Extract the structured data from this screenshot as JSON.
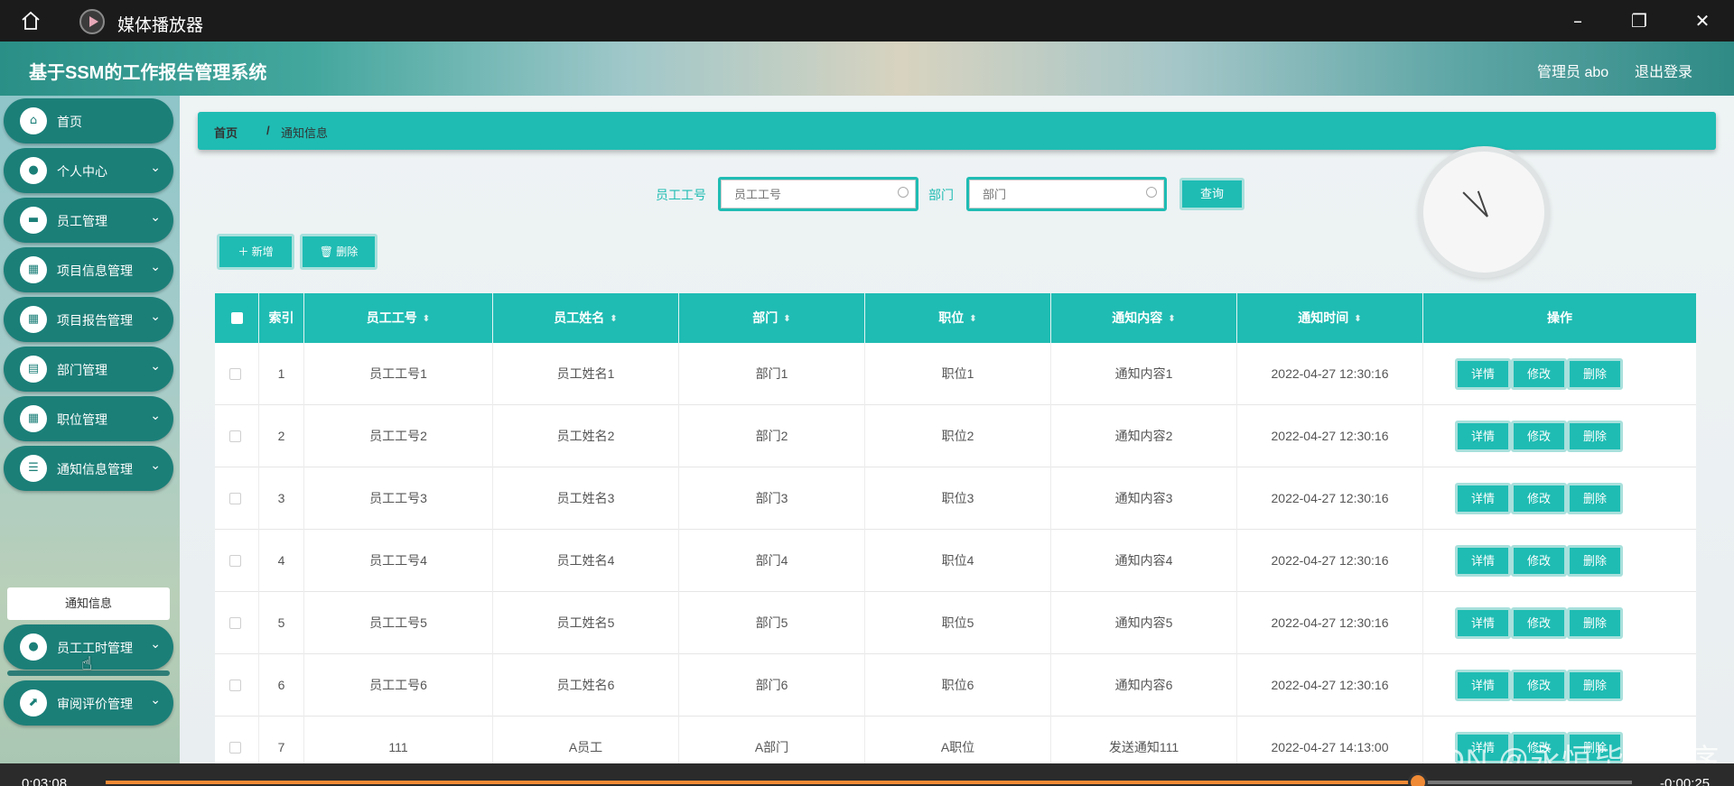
{
  "window": {
    "title": "媒体播放器"
  },
  "header": {
    "app_title": "基于SSM的工作报告管理系统",
    "user": "管理员 abo",
    "logout": "退出登录"
  },
  "sidebar": {
    "items": [
      {
        "label": "首页",
        "icon": "home-icon"
      },
      {
        "label": "个人中心",
        "icon": "user-icon"
      },
      {
        "label": "员工管理",
        "icon": "briefcase-icon"
      },
      {
        "label": "项目信息管理",
        "icon": "grid-icon"
      },
      {
        "label": "项目报告管理",
        "icon": "grid-icon"
      },
      {
        "label": "部门管理",
        "icon": "clipboard-icon"
      },
      {
        "label": "职位管理",
        "icon": "grid-icon"
      },
      {
        "label": "通知信息管理",
        "icon": "list-icon"
      },
      {
        "label": "员工工时管理",
        "icon": "person-icon"
      },
      {
        "label": "审阅评价管理",
        "icon": "chart-icon"
      }
    ],
    "sub_item": "通知信息"
  },
  "breadcrumb": {
    "home": "首页",
    "separator": "/",
    "current": "通知信息"
  },
  "search": {
    "emp_id_label": "员工工号",
    "emp_id_placeholder": "员工工号",
    "dept_label": "部门",
    "dept_placeholder": "部门",
    "query_button": "查询"
  },
  "actions": {
    "add": "＋ 新增",
    "delete": "🗑 删除"
  },
  "table": {
    "columns": [
      "索引",
      "员工工号",
      "员工姓名",
      "部门",
      "职位",
      "通知内容",
      "通知时间",
      "操作"
    ],
    "rows": [
      {
        "index": "1",
        "emp_id": "员工工号1",
        "name": "员工姓名1",
        "dept": "部门1",
        "position": "职位1",
        "content": "通知内容1",
        "time": "2022-04-27 12:30:16"
      },
      {
        "index": "2",
        "emp_id": "员工工号2",
        "name": "员工姓名2",
        "dept": "部门2",
        "position": "职位2",
        "content": "通知内容2",
        "time": "2022-04-27 12:30:16"
      },
      {
        "index": "3",
        "emp_id": "员工工号3",
        "name": "员工姓名3",
        "dept": "部门3",
        "position": "职位3",
        "content": "通知内容3",
        "time": "2022-04-27 12:30:16"
      },
      {
        "index": "4",
        "emp_id": "员工工号4",
        "name": "员工姓名4",
        "dept": "部门4",
        "position": "职位4",
        "content": "通知内容4",
        "time": "2022-04-27 12:30:16"
      },
      {
        "index": "5",
        "emp_id": "员工工号5",
        "name": "员工姓名5",
        "dept": "部门5",
        "position": "职位5",
        "content": "通知内容5",
        "time": "2022-04-27 12:30:16"
      },
      {
        "index": "6",
        "emp_id": "员工工号6",
        "name": "员工姓名6",
        "dept": "部门6",
        "position": "职位6",
        "content": "通知内容6",
        "time": "2022-04-27 12:30:16"
      },
      {
        "index": "7",
        "emp_id": "111",
        "name": "A员工",
        "dept": "A部门",
        "position": "A职位",
        "content": "发送通知111",
        "time": "2022-04-27 14:13:00"
      }
    ],
    "row_buttons": {
      "detail": "详情",
      "edit": "修改",
      "delete": "删除"
    }
  },
  "watermark": "CSDN @永恒毕设程序",
  "media": {
    "elapsed": "0:03:08",
    "remaining": "-0:00:25",
    "progress": 0.86
  },
  "colors": {
    "accent": "#1fbcb3",
    "sidebar_item": "#1b7f78",
    "progress": "#f08a35"
  }
}
